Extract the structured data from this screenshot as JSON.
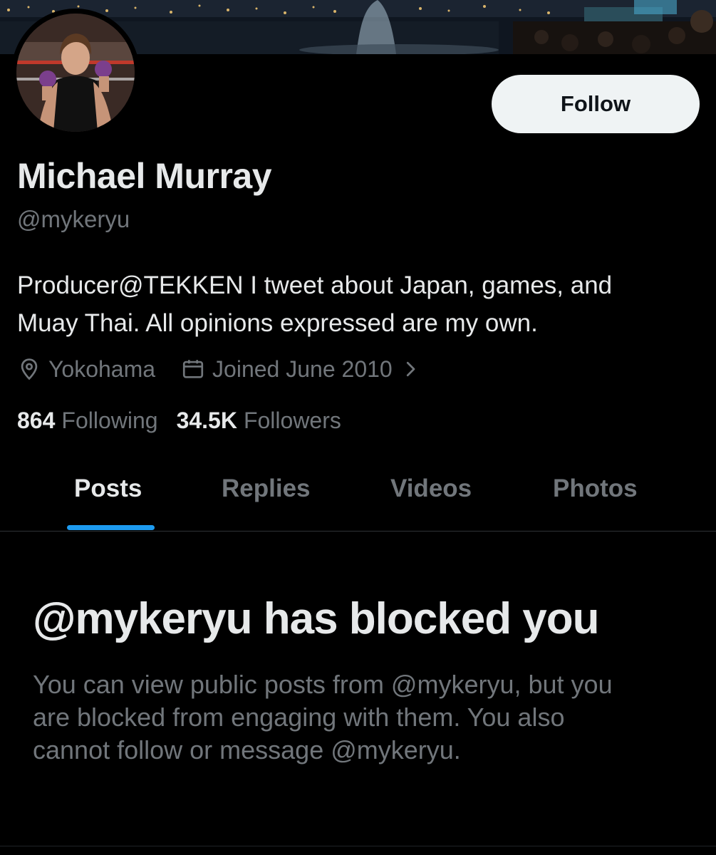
{
  "profile": {
    "display_name": "Michael Murray",
    "handle": "@mykeryu",
    "bio_line_1": "Producer@TEKKEN I tweet about Japan, games, and",
    "bio_line_2": "Muay Thai. All opinions expressed are my own.",
    "location": "Yokohama",
    "joined": "Joined June 2010"
  },
  "actions": {
    "follow_label": "Follow"
  },
  "stats": {
    "following_count": "864",
    "following_label": "Following",
    "followers_count": "34.5K",
    "followers_label": "Followers"
  },
  "tabs": [
    {
      "label": "Posts",
      "active": true
    },
    {
      "label": "Replies",
      "active": false
    },
    {
      "label": "Videos",
      "active": false
    },
    {
      "label": "Photos",
      "active": false
    }
  ],
  "blocked": {
    "title": "@mykeryu has blocked you",
    "line_1": "You can view public posts from @mykeryu, but you",
    "line_2": "are blocked from engaging with them. You also",
    "line_3": "cannot follow or message @mykeryu."
  },
  "icons": {
    "location": "location-pin-icon",
    "calendar": "calendar-icon",
    "chevron": "chevron-right-icon"
  },
  "colors": {
    "background": "#000000",
    "primary_text": "#e7e9ea",
    "secondary_text": "#71767b",
    "accent": "#1d9bf0",
    "follow_button_bg": "#eff3f4",
    "divider": "#2f3336"
  }
}
